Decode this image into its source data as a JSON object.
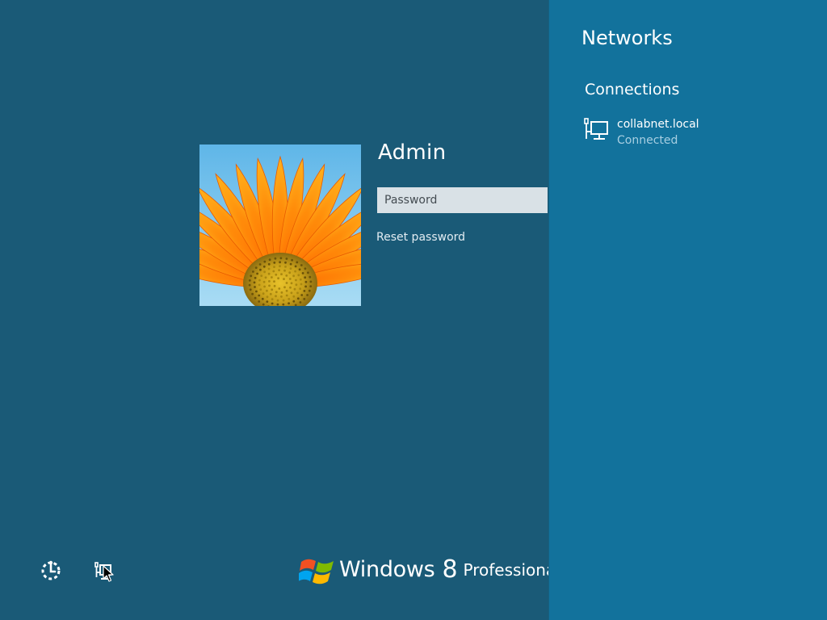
{
  "login": {
    "user_name": "Admin",
    "password_placeholder": "Password",
    "password_value": "",
    "reset_password_label": "Reset password"
  },
  "branding": {
    "windows_word": "Windows",
    "version": "8",
    "edition": "Professional"
  },
  "bottom_icons": {
    "ease_of_access_icon": "ease-of-access-icon",
    "network_icon": "network-icon"
  },
  "networks_panel": {
    "title": "Networks",
    "section_label": "Connections",
    "connections": [
      {
        "name": "collabnet.local",
        "status": "Connected",
        "icon": "wired-network-icon"
      }
    ]
  },
  "colors": {
    "background": "#1a5a77",
    "panel_background": "#12729c",
    "password_field": "#d9e1e6",
    "connected_text": "#a8cfe2"
  }
}
